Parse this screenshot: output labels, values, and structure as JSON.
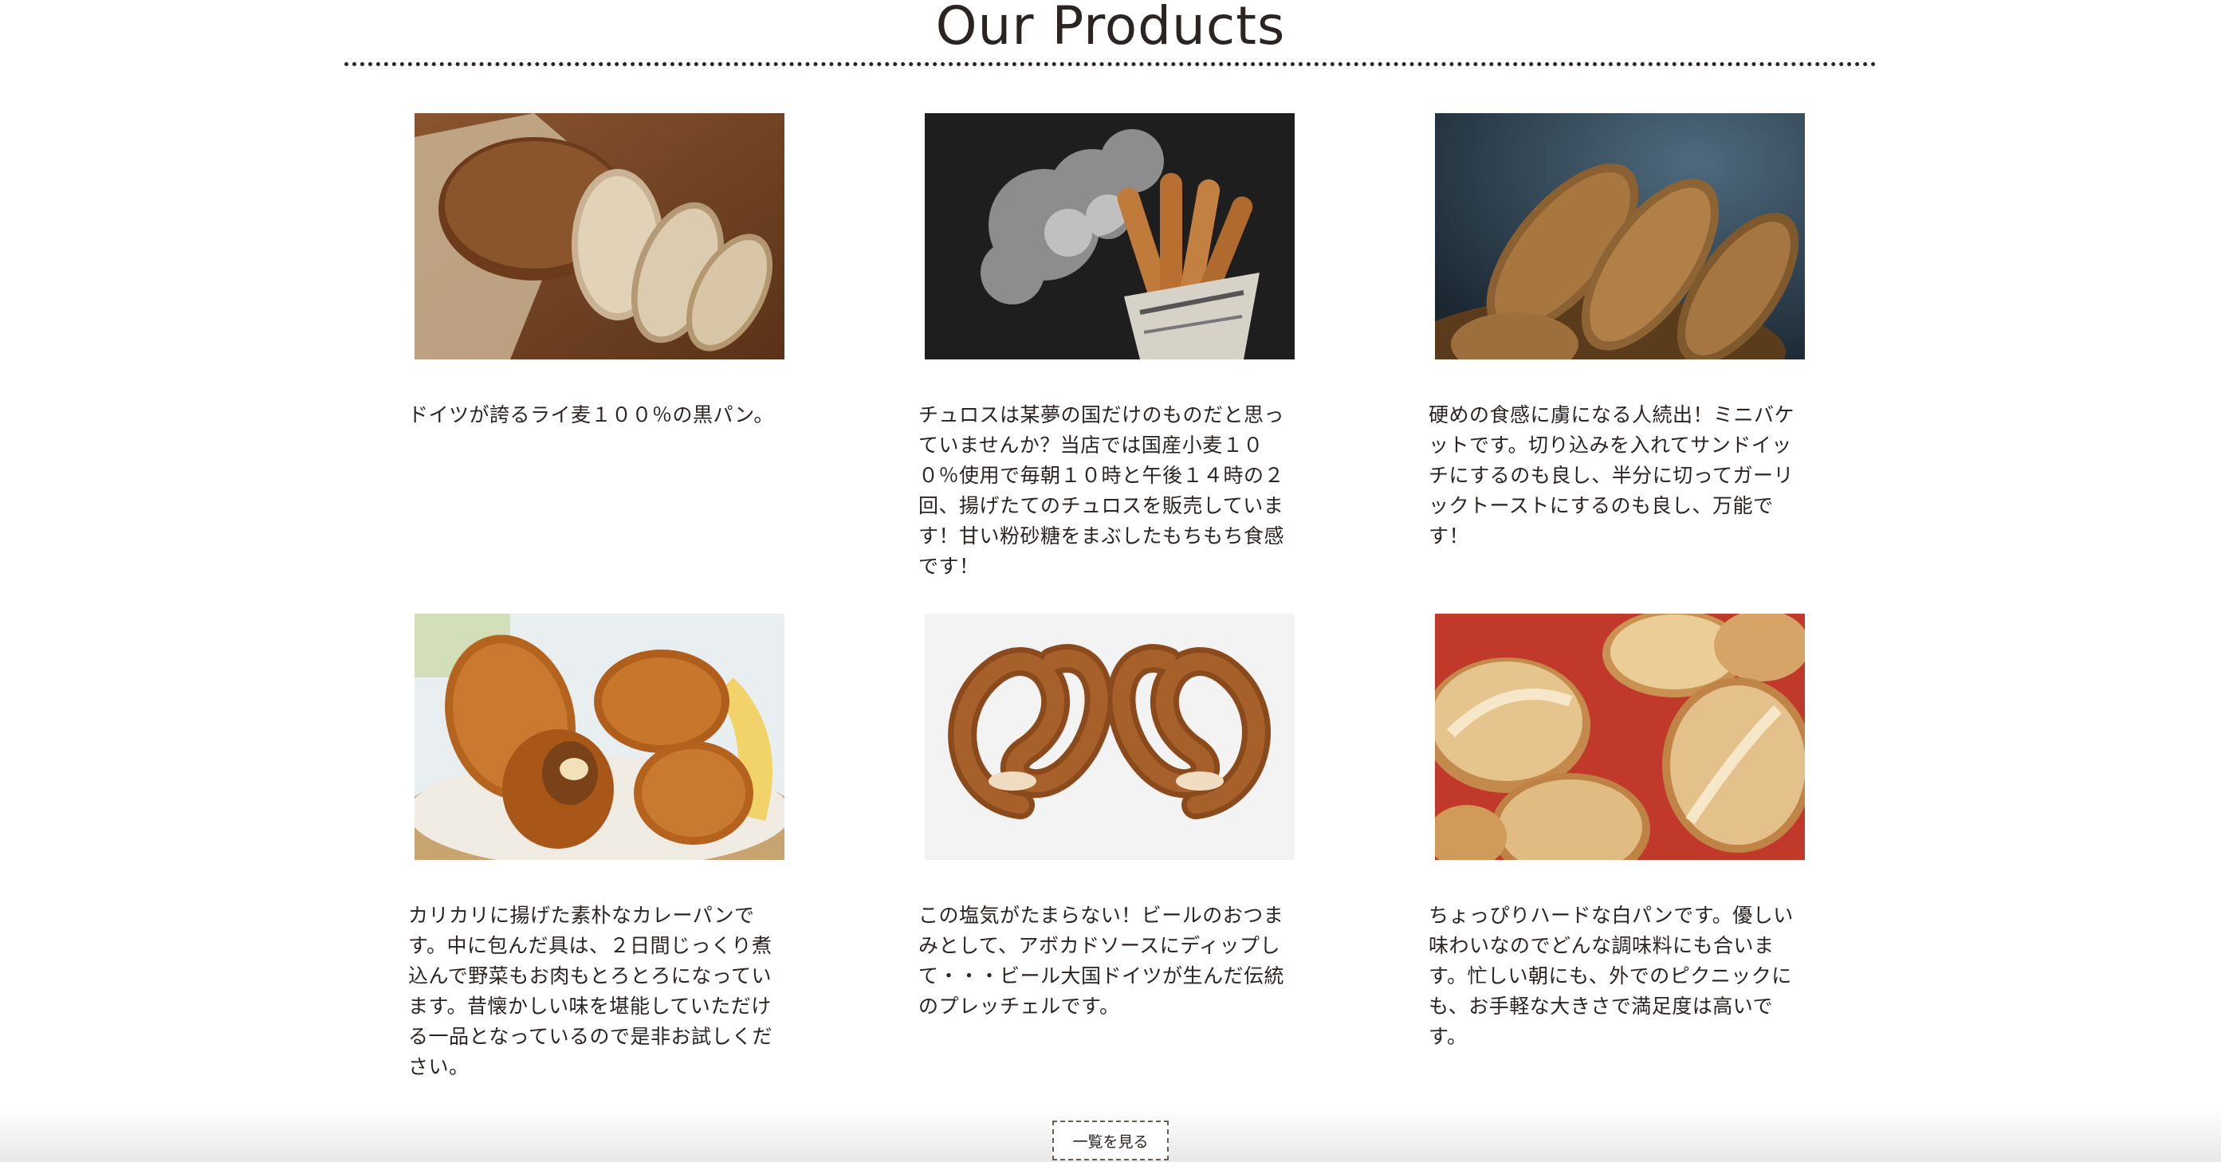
{
  "section": {
    "title": "Our Products"
  },
  "products": [
    {
      "image_icon": "rye-bread-photo",
      "description": "ドイツが誇るライ麦１００％の黒パン。"
    },
    {
      "image_icon": "churros-photo",
      "description": "チュロスは某夢の国だけのものだと思っていませんか？当店では国産小麦１００％使用で毎朝１０時と午後１４時の２回、揚げたてのチュロスを販売しています！甘い粉砂糖をまぶしたもちもち食感です！"
    },
    {
      "image_icon": "mini-baguette-photo",
      "description": "硬めの食感に虜になる人続出！ミニバケットです。切り込みを入れてサンドイッチにするのも良し、半分に切ってガーリックトーストにするのも良し、万能です！"
    },
    {
      "image_icon": "curry-bread-photo",
      "description": "カリカリに揚げた素朴なカレーパンです。中に包んだ具は、２日間じっくり煮込んで野菜もお肉もとろとろになっています。昔懐かしい味を堪能していただける一品となっているので是非お試しください。"
    },
    {
      "image_icon": "pretzel-photo",
      "description": "この塩気がたまらない！ビールのおつまみとして、アボカドソースにディップして・・・ビール大国ドイツが生んだ伝統のプレッチェルです。"
    },
    {
      "image_icon": "white-bread-rolls-photo",
      "description": "ちょっぴりハードな白パンです。優しい味わいなのでどんな調味料にも合います。忙しい朝にも、外でのピクニックにも、お手軽な大きさで満足度は高いです。"
    }
  ],
  "actions": {
    "view_all_label": "一覧を見る"
  }
}
